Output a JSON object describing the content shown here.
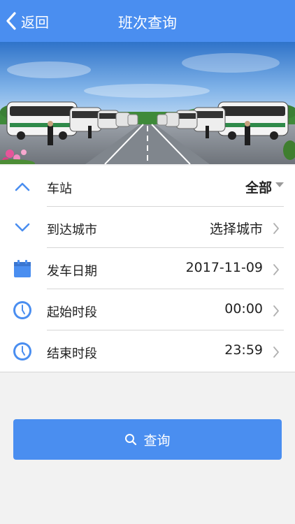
{
  "header": {
    "back_label": "返回",
    "title": "班次查询"
  },
  "banner": {
    "icon": "bus-station-photo"
  },
  "rows": [
    {
      "label": "车站",
      "value": "全部",
      "icon": "chevron-up-icon"
    },
    {
      "label": "到达城市",
      "value": "选择城市",
      "icon": "chevron-down-icon"
    },
    {
      "label": "发车日期",
      "value": "2017-11-09",
      "icon": "calendar-icon"
    },
    {
      "label": "起始时段",
      "value": "00:00",
      "icon": "clock-icon"
    },
    {
      "label": "结束时段",
      "value": "23:59",
      "icon": "clock-icon"
    }
  ],
  "search_button": {
    "label": "查询",
    "icon": "search-icon"
  },
  "colors": {
    "accent": "#4a8ef0",
    "background": "#f2f2f2",
    "text": "#222222"
  }
}
